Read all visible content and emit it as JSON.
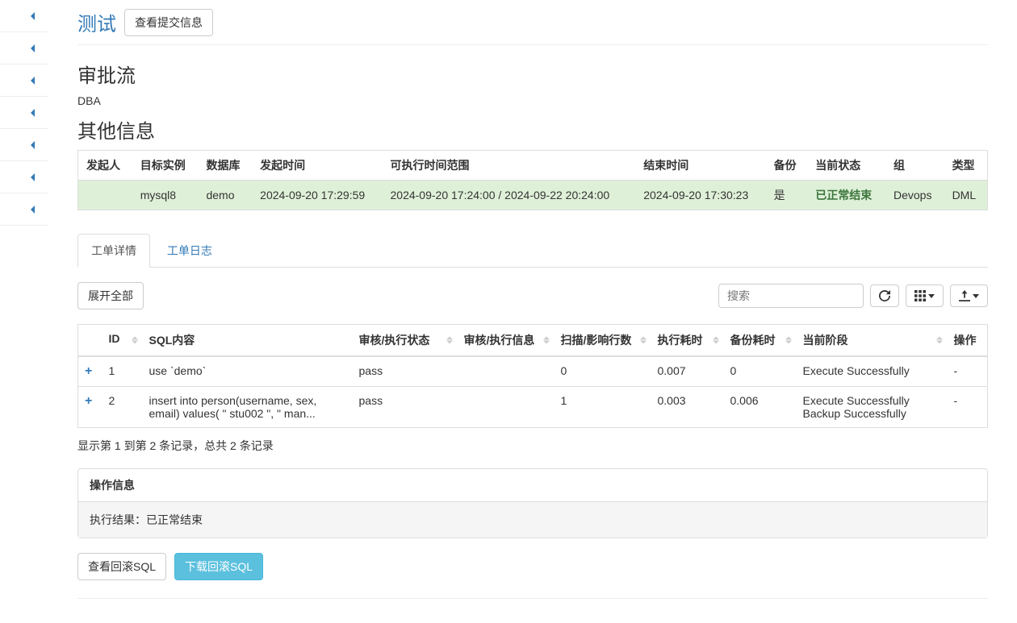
{
  "header": {
    "title": "测试",
    "submit_info_btn": "查看提交信息"
  },
  "approval": {
    "heading": "审批流",
    "role": "DBA"
  },
  "other_info": {
    "heading": "其他信息",
    "columns": [
      "发起人",
      "目标实例",
      "数据库",
      "发起时间",
      "可执行时间范围",
      "结束时间",
      "备份",
      "当前状态",
      "组",
      "类型"
    ],
    "row": {
      "initiator": "",
      "instance": "mysql8",
      "database": "demo",
      "start_time": "2024-09-20 17:29:59",
      "exec_window": "2024-09-20 17:24:00 / 2024-09-22 20:24:00",
      "end_time": "2024-09-20 17:30:23",
      "backup": "是",
      "status": "已正常结束",
      "group": "Devops",
      "type": "DML"
    }
  },
  "tabs": {
    "detail": "工单详情",
    "log": "工单日志"
  },
  "toolbar": {
    "expand_all": "展开全部",
    "search_placeholder": "搜索"
  },
  "sql_table": {
    "columns": {
      "id": "ID",
      "content": "SQL内容",
      "status": "审核/执行状态",
      "info": "审核/执行信息",
      "rows": "扫描/影响行数",
      "exec_time": "执行耗时",
      "backup_time": "备份耗时",
      "stage": "当前阶段",
      "action": "操作"
    },
    "rows": [
      {
        "id": "1",
        "content": "use `demo`",
        "status": "pass",
        "info": "",
        "rows": "0",
        "exec_time": "0.007",
        "backup_time": "0",
        "stage": "Execute Successfully",
        "action": "-"
      },
      {
        "id": "2",
        "content": "insert into person(username, sex, email) values( \" stu002 \", \" man...",
        "status": "pass",
        "info": "",
        "rows": "1",
        "exec_time": "0.003",
        "backup_time": "0.006",
        "stage": "Execute Successfully\nBackup Successfully",
        "action": "-"
      }
    ]
  },
  "pager": "显示第 1 到第 2 条记录，总共 2 条记录",
  "op_panel": {
    "title": "操作信息",
    "result_label": "执行结果：",
    "result_value": "已正常结束"
  },
  "actions": {
    "view_rollback": "查看回滚SQL",
    "download_rollback": "下载回滚SQL"
  }
}
